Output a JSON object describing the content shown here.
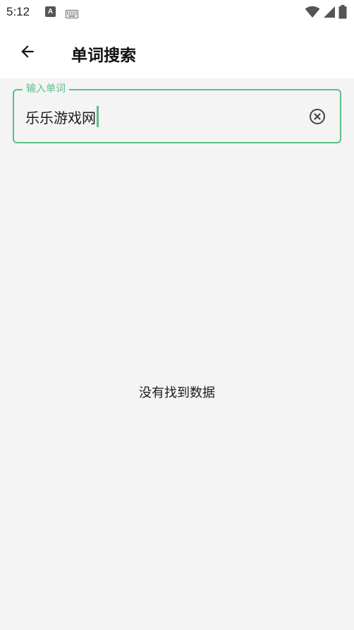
{
  "status_bar": {
    "time": "5:12",
    "icons": [
      "a-notification-icon",
      "keyboard-icon",
      "wifi-icon",
      "signal-icon",
      "battery-icon"
    ]
  },
  "app_bar": {
    "title": "单词搜索",
    "back_icon": "arrow-left-icon"
  },
  "search": {
    "label": "输入单词",
    "value": "乐乐游戏网",
    "clear_icon": "clear-circle-icon",
    "accent_color": "#5cc08a"
  },
  "empty_state": {
    "message": "没有找到数据"
  }
}
